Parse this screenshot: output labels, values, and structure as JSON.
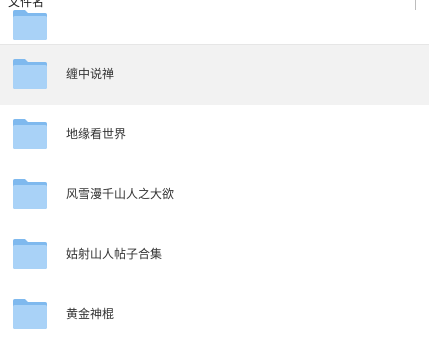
{
  "header": {
    "column_label": "文件名"
  },
  "colors": {
    "folder_back": "#7fb9ee",
    "folder_front": "#a9d2f7",
    "hover_row": "#f2f2f2",
    "text": "#333333"
  },
  "items": [
    {
      "name": "缠中说禅",
      "icon": "folder-icon",
      "hovered": true
    },
    {
      "name": "地缘看世界",
      "icon": "folder-icon",
      "hovered": false
    },
    {
      "name": "风雪漫千山人之大欲",
      "icon": "folder-icon",
      "hovered": false
    },
    {
      "name": "姑射山人帖子合集",
      "icon": "folder-icon",
      "hovered": false
    },
    {
      "name": "黄金神棍",
      "icon": "folder-icon",
      "hovered": false
    }
  ]
}
